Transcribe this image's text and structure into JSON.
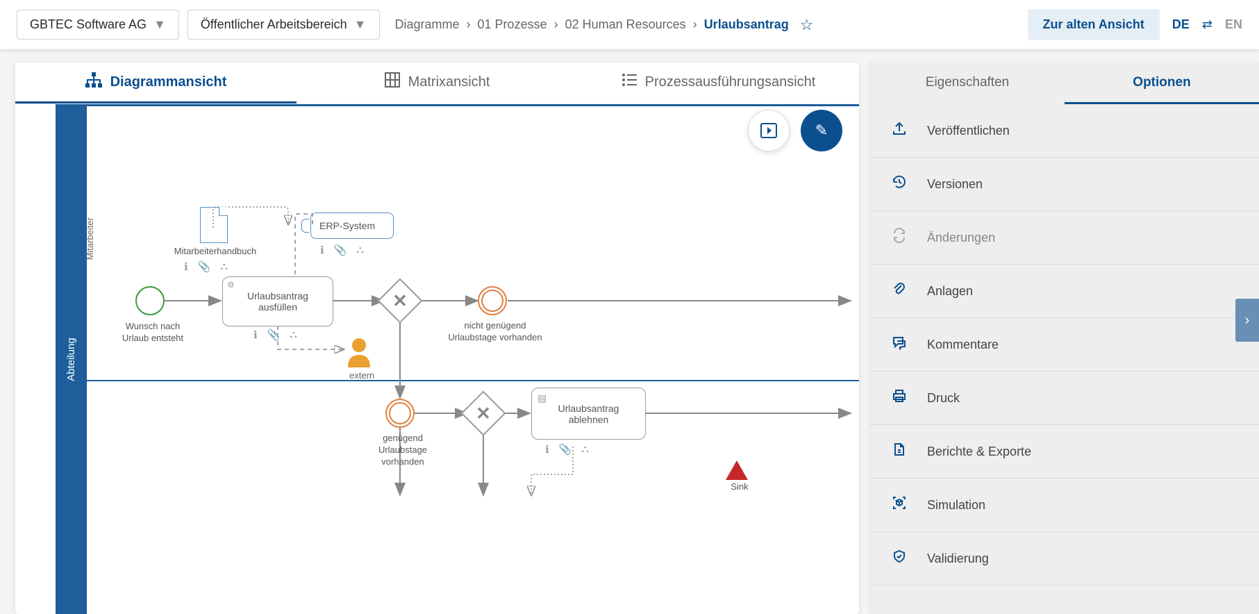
{
  "header": {
    "org_dropdown": "GBTEC Software AG",
    "workspace_dropdown": "Öffentlicher Arbeitsbereich",
    "breadcrumb": [
      "Diagramme",
      "01 Prozesse",
      "02 Human Resources",
      "Urlaubsantrag"
    ],
    "old_view_btn": "Zur alten Ansicht",
    "lang_active": "DE",
    "lang_inactive": "EN"
  },
  "tabs": {
    "diagram": "Diagrammansicht",
    "matrix": "Matrixansicht",
    "execution": "Prozessausführungsansicht"
  },
  "bpmn": {
    "pool": "Abteilung",
    "lane_employee": "Mitarbeiter",
    "start_label": "Wunsch nach Urlaub entsteht",
    "task_fill": "Urlaubsantrag ausfüllen",
    "task_reject": "Urlaubsantrag ablehnen",
    "gateway_not_enough": "nicht genügend Urlaubstage vorhanden",
    "gateway_enough": "genügend Urlaubstage vorhanden",
    "data_handbook": "Mitarbeiterhandbuch",
    "data_erp": "ERP-System",
    "role_extern": "extern",
    "warn_label": "Sink"
  },
  "side": {
    "tab_props": "Eigenschaften",
    "tab_options": "Optionen",
    "items": [
      {
        "icon": "publish",
        "label": "Veröffentlichen"
      },
      {
        "icon": "history",
        "label": "Versionen"
      },
      {
        "icon": "changes",
        "label": "Änderungen",
        "disabled": true
      },
      {
        "icon": "attach",
        "label": "Anlagen"
      },
      {
        "icon": "comment",
        "label": "Kommentare"
      },
      {
        "icon": "print",
        "label": "Druck"
      },
      {
        "icon": "report",
        "label": "Berichte & Exporte"
      },
      {
        "icon": "sim",
        "label": "Simulation"
      },
      {
        "icon": "valid",
        "label": "Validierung"
      }
    ]
  }
}
